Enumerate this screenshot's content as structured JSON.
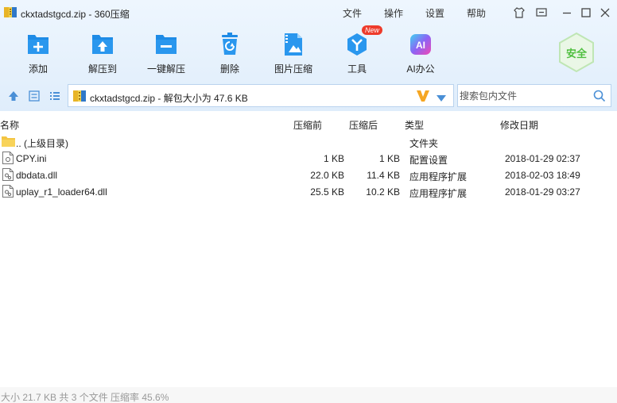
{
  "window": {
    "title": "ckxtadstgcd.zip - 360压缩",
    "menus": [
      "文件",
      "操作",
      "设置",
      "帮助"
    ]
  },
  "toolbar": {
    "buttons": [
      {
        "label": "添加",
        "icon": "add-archive-icon"
      },
      {
        "label": "解压到",
        "icon": "extract-to-icon"
      },
      {
        "label": "一键解压",
        "icon": "one-click-extract-icon"
      },
      {
        "label": "删除",
        "icon": "delete-icon"
      },
      {
        "label": "图片压缩",
        "icon": "image-compress-icon"
      },
      {
        "label": "工具",
        "icon": "tools-icon",
        "badge": "New"
      },
      {
        "label": "AI办公",
        "icon": "ai-office-icon",
        "icon_text": "AI"
      }
    ],
    "security_label": "安全"
  },
  "address": {
    "path": "ckxtadstgcd.zip - 解包大小为 47.6 KB",
    "search_placeholder": "搜索包内文件"
  },
  "columns": {
    "name": "名称",
    "compressed": "压缩前",
    "uncompressed": "压缩后",
    "type": "类型",
    "modified": "修改日期"
  },
  "files": [
    {
      "name": ".. (上级目录)",
      "compressed": "",
      "uncompressed": "",
      "type": "文件夹",
      "modified": "",
      "icon": "folder-icon"
    },
    {
      "name": "CPY.ini",
      "compressed": "1 KB",
      "uncompressed": "1 KB",
      "type": "配置设置",
      "modified": "2018-01-29 02:37",
      "icon": "ini-file-icon"
    },
    {
      "name": "dbdata.dll",
      "compressed": "22.0 KB",
      "uncompressed": "11.4 KB",
      "type": "应用程序扩展",
      "modified": "2018-02-03 18:49",
      "icon": "dll-file-icon"
    },
    {
      "name": "uplay_r1_loader64.dll",
      "compressed": "25.5 KB",
      "uncompressed": "10.2 KB",
      "type": "应用程序扩展",
      "modified": "2018-01-29 03:27",
      "icon": "dll-file-icon"
    }
  ],
  "status": {
    "text": "大小 21.7 KB 共 3 个文件 压缩率 45.6%"
  },
  "colors": {
    "toolbar_icon": "#1e8be6",
    "toolbar_icon_light": "#4fb0f5",
    "security_green": "#4fbf3f",
    "chrome_bg": "#e4f0fc",
    "badge_red": "#ee3b2b"
  }
}
